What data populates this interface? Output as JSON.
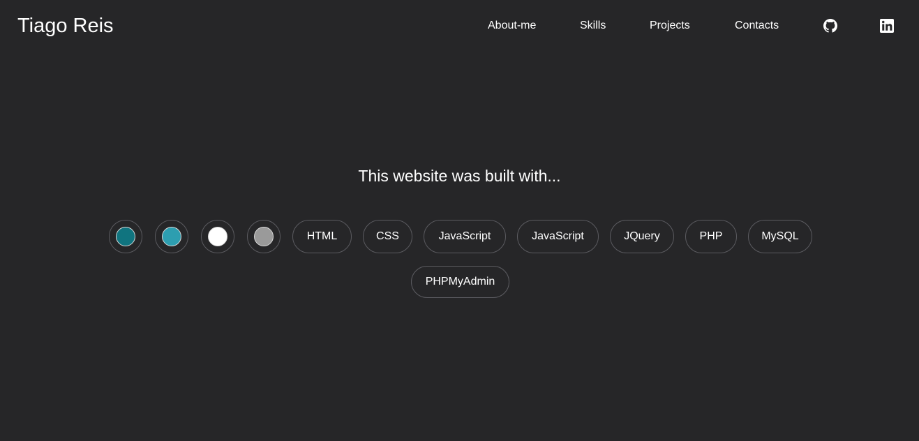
{
  "navbar": {
    "brand": "Tiago Reis",
    "links": {
      "about": "About-me",
      "skills": "Skills",
      "projects": "Projects",
      "contacts": "Contacts"
    },
    "icons": [
      "github-icon",
      "linkedin-icon"
    ]
  },
  "main": {
    "heading": "This website was built with...",
    "color_swatches": [
      "#10747f",
      "#2d9eb0",
      "#ffffff",
      "#9a9a9a"
    ],
    "tags": [
      "HTML",
      "CSS",
      "JavaScript",
      "JavaScript",
      "JQuery",
      "PHP",
      "MySQL",
      "PHPMyAdmin"
    ]
  },
  "colors": {
    "background": "#262628",
    "text": "#ffffff",
    "pill_border": "#5b5b60"
  }
}
